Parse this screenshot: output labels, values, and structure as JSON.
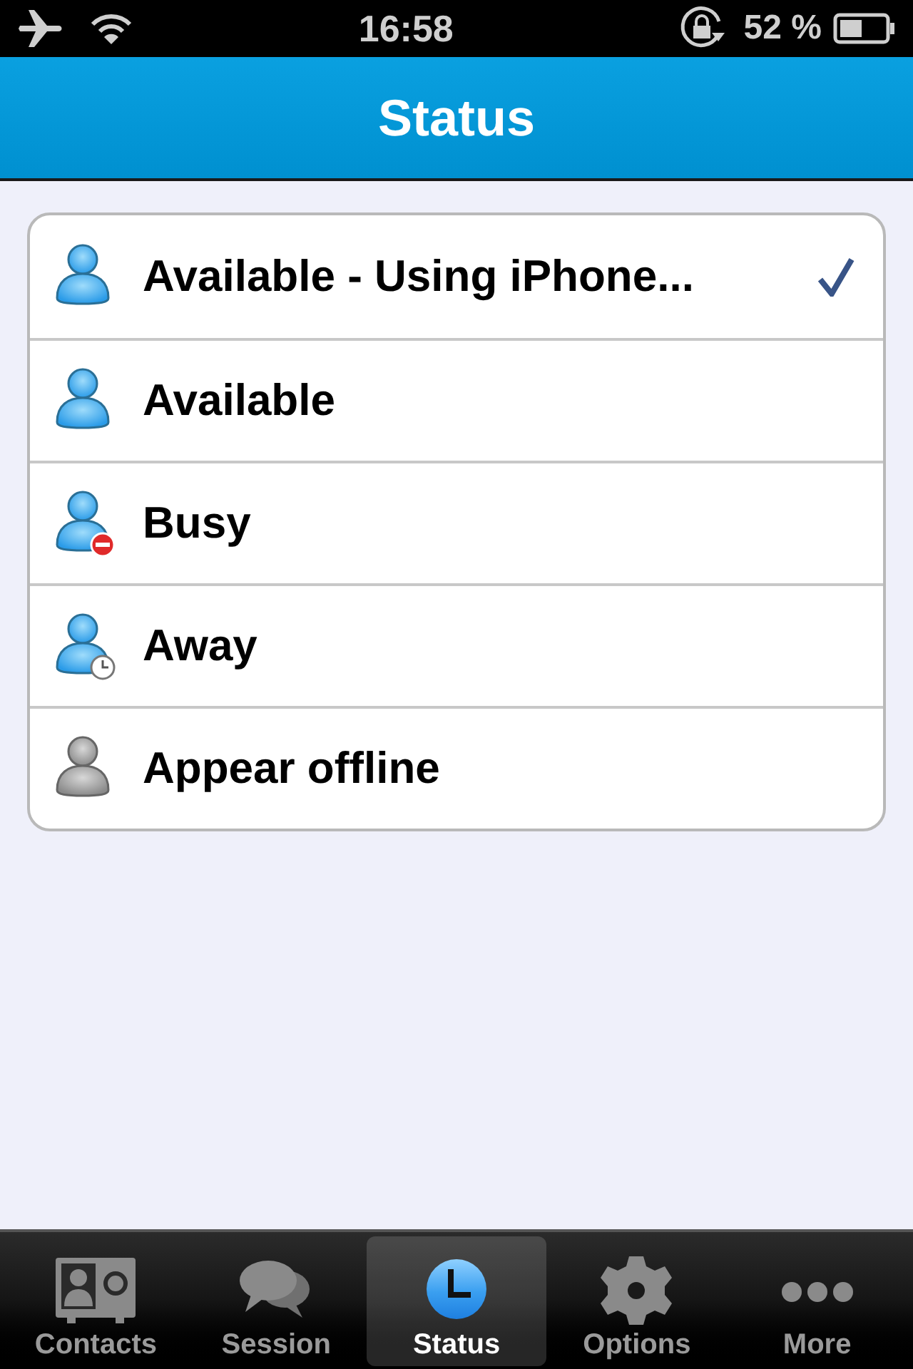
{
  "status_bar": {
    "time": "16:58",
    "battery": "52 %"
  },
  "nav_bar": {
    "title": "Status"
  },
  "statuses": [
    {
      "label": "Available - Using iPhone...",
      "kind": "available",
      "selected": true
    },
    {
      "label": "Available",
      "kind": "available",
      "selected": false
    },
    {
      "label": "Busy",
      "kind": "busy",
      "selected": false
    },
    {
      "label": "Away",
      "kind": "away",
      "selected": false
    },
    {
      "label": "Appear offline",
      "kind": "offline",
      "selected": false
    }
  ],
  "tab_bar": [
    {
      "label": "Contacts",
      "kind": "contacts",
      "selected": false
    },
    {
      "label": "Session",
      "kind": "session",
      "selected": false
    },
    {
      "label": "Status",
      "kind": "status",
      "selected": true
    },
    {
      "label": "Options",
      "kind": "options",
      "selected": false
    },
    {
      "label": "More",
      "kind": "more",
      "selected": false
    }
  ]
}
